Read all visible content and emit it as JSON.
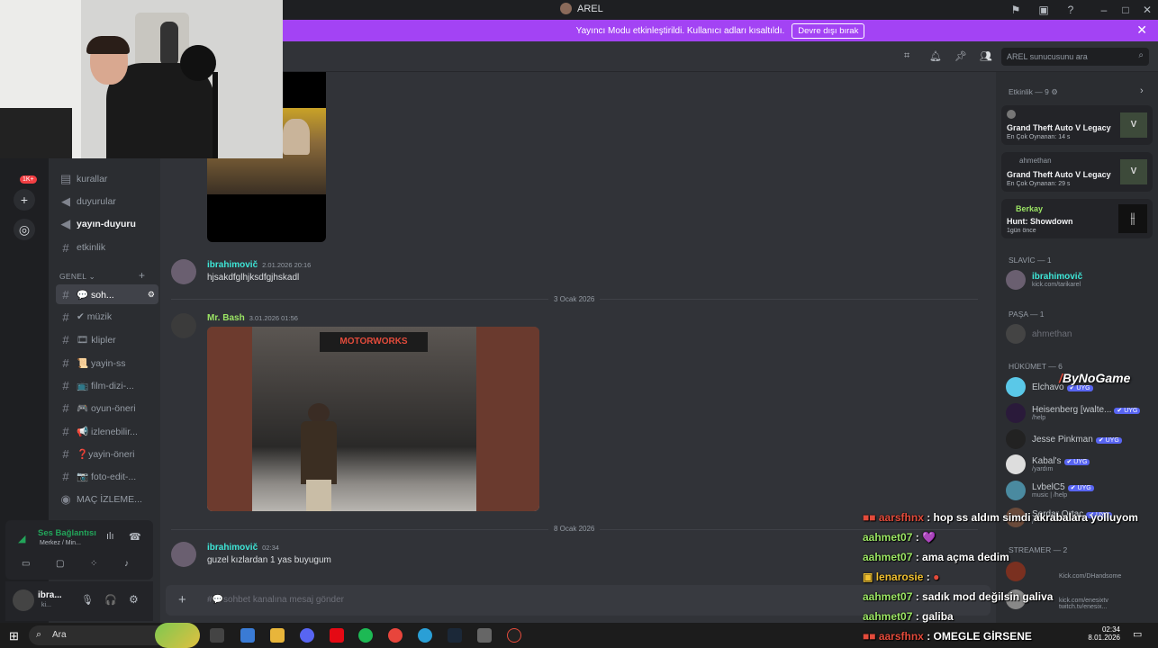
{
  "window": {
    "title": "AREL"
  },
  "banner": {
    "text": "Yayıncı Modu etkinleştirildi. Kullanıcı adları kısaltıldı.",
    "button": "Devre dışı bırak"
  },
  "rail": {
    "badge": "1K+"
  },
  "sidebar": {
    "channels_top": [
      {
        "label": "kurallar",
        "icon": "rules-icon"
      },
      {
        "label": "duyurular",
        "icon": "megaphone-icon"
      },
      {
        "label": "yayın-duyuru",
        "icon": "megaphone-icon"
      },
      {
        "label": "etkinlik",
        "icon": "hash-icon"
      }
    ],
    "category": "GENEL",
    "channels": [
      "💬 soh...",
      "✔ müzik",
      "🎞 klipler",
      "📜 yayin-ss",
      "📺 film-dizi-...",
      "🎮 oyun-öneri",
      "📢 izlenebilir...",
      "❓yayin-öneri",
      "📷 foto-edit-...",
      "MAÇ İZLEME..."
    ]
  },
  "voice": {
    "status": "Ses Bağlantısı",
    "channel": "Merkez / Min..."
  },
  "user": {
    "name": "ibra...",
    "sub": "ki..."
  },
  "chat": {
    "messages": [
      {
        "author": "ibrahimovič",
        "time": "2.01.2026 20:16",
        "text": "hjsakdfglhjksdfgjhskadl"
      },
      {
        "author": "Mr. Bash",
        "time": "3.01.2026 01:56",
        "text": ""
      },
      {
        "author": "ibrahimovič",
        "time": "02:34",
        "text": "guzel kızlardan 1 yas buyugum"
      }
    ],
    "dates": [
      "3 Ocak 2026",
      "8 Ocak 2026"
    ],
    "input_placeholder": "#💬sohbet kanalına mesaj gönder"
  },
  "header": {
    "search_placeholder": "AREL sunucusunu ara"
  },
  "members": {
    "activity_title": "Etkinlik — 9",
    "activities": [
      {
        "game": "Grand Theft Auto V Legacy",
        "sub": "En Çok Oynanan: 14 s",
        "user": ""
      },
      {
        "game": "Grand Theft Auto V Legacy",
        "sub": "En Çok Oynanan: 29 s",
        "user": "ahmethan"
      },
      {
        "game": "Hunt: Showdown",
        "sub": "1gün önce",
        "user": "Berkay"
      }
    ],
    "groups": [
      {
        "title": "SLAVİC — 1",
        "items": [
          {
            "name": "ibrahimovič",
            "sub": "kick.com/tarikarel",
            "tag": ""
          }
        ]
      },
      {
        "title": "PAŞA — 1",
        "items": [
          {
            "name": "ahmethan",
            "sub": "",
            "tag": ""
          }
        ]
      },
      {
        "title": "HÜKÜMET — 6",
        "items": [
          {
            "name": "Elchavo",
            "sub": "",
            "tag": "UYG"
          },
          {
            "name": "Heisenberg [walte...",
            "sub": "/help",
            "tag": "UYG"
          },
          {
            "name": "Jesse Pinkman",
            "sub": "",
            "tag": "UYG"
          },
          {
            "name": "Kabal's",
            "sub": "/yardım",
            "tag": "UYG"
          },
          {
            "name": "LvbelC5",
            "sub": "music | /help",
            "tag": "UYG"
          },
          {
            "name": "Serdar Ortaç",
            "sub": "/",
            "tag": "UYG"
          }
        ]
      },
      {
        "title": "STREAMER — 2",
        "items": [
          {
            "name": "",
            "sub": "Kick.com/DHandsome",
            "tag": ""
          },
          {
            "name": "",
            "sub": "kick.com/enesixtv twitch.tv/enesix...",
            "tag": ""
          }
        ]
      }
    ]
  },
  "overlay": {
    "watermark": "ByNoGame",
    "lines": [
      {
        "user": "",
        "text": "hop ss aldım simdi akrabalara yolluyom"
      },
      {
        "user": "aahmet07",
        "text": "💜"
      },
      {
        "user": "aahmet07",
        "text": "ama açma dedim"
      },
      {
        "user": "lenarosie",
        "text": ""
      },
      {
        "user": "aahmet07",
        "text": "sadık mod değilsin galiva"
      },
      {
        "user": "aahmet07",
        "text": "galiba"
      },
      {
        "user": "",
        "text": "OMEGLE GİRSENE"
      }
    ]
  },
  "taskbar": {
    "search": "Ara",
    "time": "02:34",
    "date": "8.01.2026"
  }
}
